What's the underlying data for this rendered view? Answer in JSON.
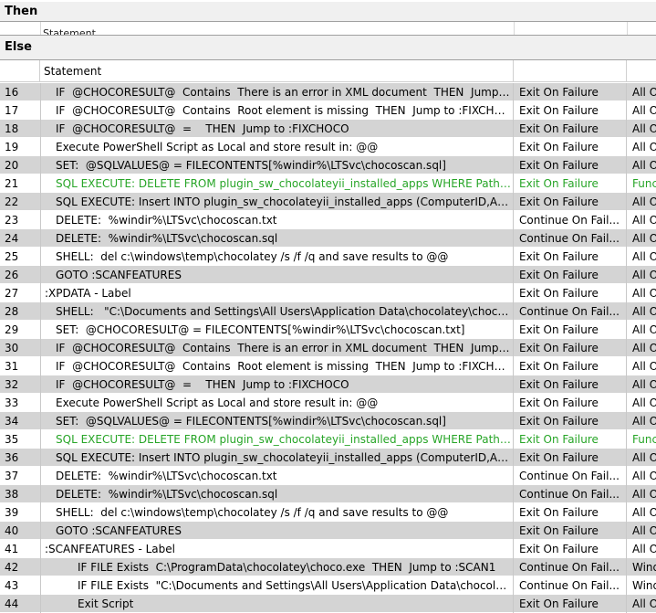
{
  "then_section": {
    "title": "Then",
    "column_header": "Statement"
  },
  "else_section": {
    "title": "Else"
  },
  "columns": {
    "statement": "Statement",
    "action": "",
    "scope": ""
  },
  "rows": [
    {
      "n": "16",
      "indent": 2,
      "text": "IF  @CHOCORESULT@  Contains  There is an error in XML document  THEN  Jump t...",
      "action": "Exit On Failure",
      "scope": "All O",
      "shade": true,
      "green": false
    },
    {
      "n": "17",
      "indent": 2,
      "text": "IF  @CHOCORESULT@  Contains  Root element is missing  THEN  Jump to :FIXCHOCO",
      "action": "Exit On Failure",
      "scope": "All O",
      "shade": false,
      "green": false
    },
    {
      "n": "18",
      "indent": 2,
      "text": "IF  @CHOCORESULT@  =    THEN  Jump to :FIXCHOCO",
      "action": "Exit On Failure",
      "scope": "All O",
      "shade": true,
      "green": false
    },
    {
      "n": "19",
      "indent": 2,
      "text": "Execute PowerShell Script as Local and store result in: @@",
      "action": "Exit On Failure",
      "scope": "All O",
      "shade": false,
      "green": false
    },
    {
      "n": "20",
      "indent": 2,
      "text": "SET:  @SQLVALUES@ = FILECONTENTS[%windir%\\LTSvc\\chocoscan.sql]",
      "action": "Exit On Failure",
      "scope": "All O",
      "shade": true,
      "green": false
    },
    {
      "n": "21",
      "indent": 2,
      "text": "SQL EXECUTE: DELETE FROM plugin_sw_chocolateyii_installed_apps WHERE Path is ...",
      "action": "Exit On Failure",
      "scope": "Func",
      "shade": false,
      "green": true
    },
    {
      "n": "22",
      "indent": 2,
      "text": "SQL EXECUTE: Insert INTO plugin_sw_chocolateyii_installed_apps (ComputerID,Appli...",
      "action": "Exit On Failure",
      "scope": "All O",
      "shade": true,
      "green": false
    },
    {
      "n": "23",
      "indent": 2,
      "text": "DELETE:  %windir%\\LTSvc\\chocoscan.txt",
      "action": "Continue On Fail...",
      "scope": "All O",
      "shade": false,
      "green": false
    },
    {
      "n": "24",
      "indent": 2,
      "text": "DELETE:  %windir%\\LTSvc\\chocoscan.sql",
      "action": "Continue On Fail...",
      "scope": "All O",
      "shade": true,
      "green": false
    },
    {
      "n": "25",
      "indent": 2,
      "text": "SHELL:  del c:\\windows\\temp\\chocolatey /s /f /q and save results to @@",
      "action": "Exit On Failure",
      "scope": "All O",
      "shade": false,
      "green": false
    },
    {
      "n": "26",
      "indent": 2,
      "text": "GOTO :SCANFEATURES",
      "action": "Exit On Failure",
      "scope": "All O",
      "shade": true,
      "green": false
    },
    {
      "n": "27",
      "indent": 1,
      "text": ":XPDATA - Label",
      "action": "Exit On Failure",
      "scope": "All O",
      "shade": false,
      "green": false
    },
    {
      "n": "28",
      "indent": 2,
      "text": "SHELL:   \"C:\\Documents and Settings\\All Users\\Application Data\\chocolatey\\choco.ex...",
      "action": "Continue On Fail...",
      "scope": "All O",
      "shade": true,
      "green": false
    },
    {
      "n": "29",
      "indent": 2,
      "text": "SET:  @CHOCORESULT@ = FILECONTENTS[%windir%\\LTSvc\\chocoscan.txt]",
      "action": "Exit On Failure",
      "scope": "All O",
      "shade": false,
      "green": false
    },
    {
      "n": "30",
      "indent": 2,
      "text": "IF  @CHOCORESULT@  Contains  There is an error in XML document  THEN  Jump t...",
      "action": "Exit On Failure",
      "scope": "All O",
      "shade": true,
      "green": false
    },
    {
      "n": "31",
      "indent": 2,
      "text": "IF  @CHOCORESULT@  Contains  Root element is missing  THEN  Jump to :FIXCHOCO",
      "action": "Exit On Failure",
      "scope": "All O",
      "shade": false,
      "green": false
    },
    {
      "n": "32",
      "indent": 2,
      "text": "IF  @CHOCORESULT@  =    THEN  Jump to :FIXCHOCO",
      "action": "Exit On Failure",
      "scope": "All O",
      "shade": true,
      "green": false
    },
    {
      "n": "33",
      "indent": 2,
      "text": "Execute PowerShell Script as Local and store result in: @@",
      "action": "Exit On Failure",
      "scope": "All O",
      "shade": false,
      "green": false
    },
    {
      "n": "34",
      "indent": 2,
      "text": "SET:  @SQLVALUES@ = FILECONTENTS[%windir%\\LTSvc\\chocoscan.sql]",
      "action": "Exit On Failure",
      "scope": "All O",
      "shade": true,
      "green": false
    },
    {
      "n": "35",
      "indent": 2,
      "text": "SQL EXECUTE: DELETE FROM plugin_sw_chocolateyii_installed_apps WHERE Path is ...",
      "action": "Exit On Failure",
      "scope": "Func",
      "shade": false,
      "green": true
    },
    {
      "n": "36",
      "indent": 2,
      "text": "SQL EXECUTE: Insert INTO plugin_sw_chocolateyii_installed_apps (ComputerID,Appli...",
      "action": "Exit On Failure",
      "scope": "All O",
      "shade": true,
      "green": false
    },
    {
      "n": "37",
      "indent": 2,
      "text": "DELETE:  %windir%\\LTSvc\\chocoscan.txt",
      "action": "Continue On Fail...",
      "scope": "All O",
      "shade": false,
      "green": false
    },
    {
      "n": "38",
      "indent": 2,
      "text": "DELETE:  %windir%\\LTSvc\\chocoscan.sql",
      "action": "Continue On Fail...",
      "scope": "All O",
      "shade": true,
      "green": false
    },
    {
      "n": "39",
      "indent": 2,
      "text": "SHELL:  del c:\\windows\\temp\\chocolatey /s /f /q and save results to @@",
      "action": "Exit On Failure",
      "scope": "All O",
      "shade": false,
      "green": false
    },
    {
      "n": "40",
      "indent": 2,
      "text": "GOTO :SCANFEATURES",
      "action": "Exit On Failure",
      "scope": "All O",
      "shade": true,
      "green": false
    },
    {
      "n": "41",
      "indent": 1,
      "text": ":SCANFEATURES - Label",
      "action": "Exit On Failure",
      "scope": "All O",
      "shade": false,
      "green": false
    },
    {
      "n": "42",
      "indent": 3,
      "text": "IF FILE Exists  C:\\ProgramData\\chocolatey\\choco.exe  THEN  Jump to :SCAN1",
      "action": "Continue On Fail...",
      "scope": "Wind",
      "shade": true,
      "green": false
    },
    {
      "n": "43",
      "indent": 3,
      "text": "IF FILE Exists  \"C:\\Documents and Settings\\All Users\\Application Data\\chocolatey...",
      "action": "Continue On Fail...",
      "scope": "Wind",
      "shade": false,
      "green": false
    },
    {
      "n": "44",
      "indent": 3,
      "text": "Exit Script",
      "action": "Exit On Failure",
      "scope": "All O",
      "shade": true,
      "green": false
    }
  ]
}
